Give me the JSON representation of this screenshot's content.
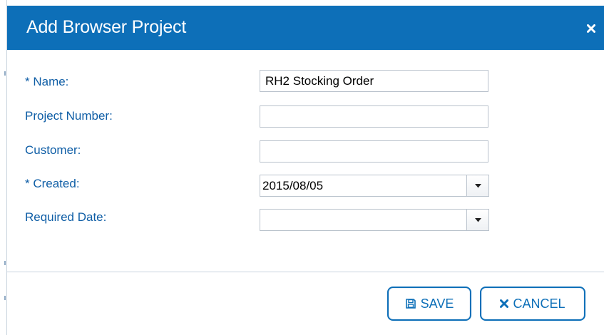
{
  "dialog": {
    "title": "Add Browser Project",
    "close_icon": "close-icon"
  },
  "form": {
    "name": {
      "label": "* Name:",
      "value": "RH2 Stocking Order"
    },
    "project_number": {
      "label": "Project Number:",
      "value": ""
    },
    "customer": {
      "label": "Customer:",
      "value": ""
    },
    "created": {
      "label": "* Created:",
      "value": "2015/08/05"
    },
    "required_date": {
      "label": "Required Date:",
      "value": ""
    }
  },
  "buttons": {
    "save_label": "SAVE",
    "save_icon": "floppy-disk-icon",
    "cancel_label": "CANCEL",
    "cancel_icon": "close-icon"
  },
  "colors": {
    "titlebar": "#0d6fb8",
    "label": "#0f5ea6",
    "button_border": "#0d6fb8"
  }
}
